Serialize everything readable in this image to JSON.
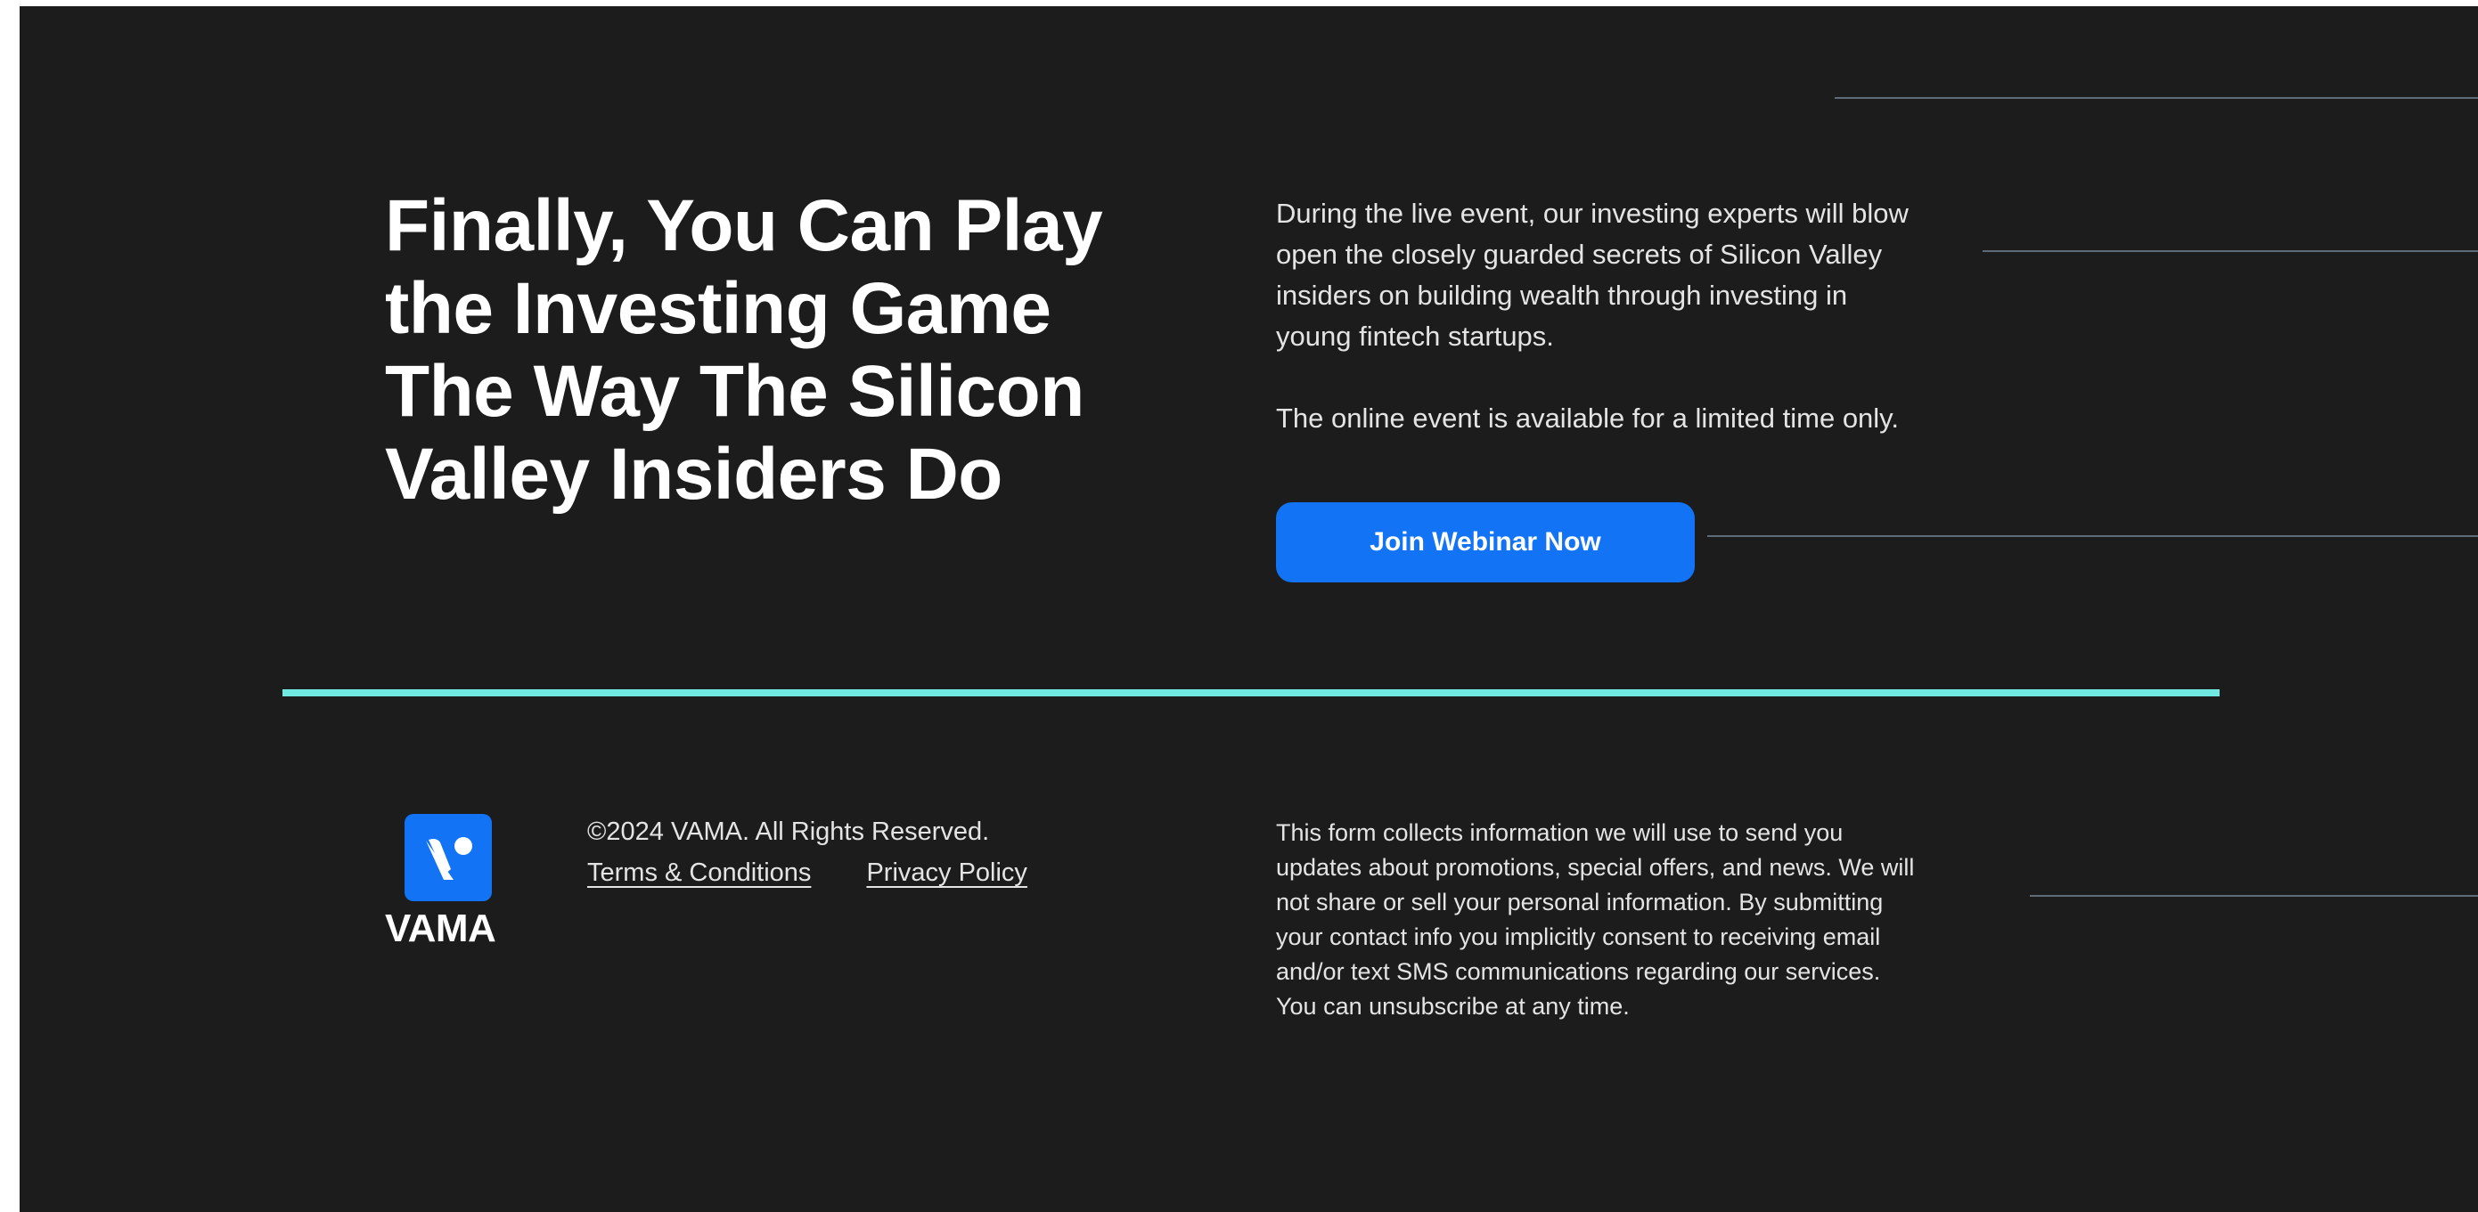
{
  "hero": {
    "headline_lines": [
      "Finally, You Can Play",
      "the Investing Game",
      "The Way The Silicon",
      "Valley Insiders Do"
    ],
    "intro_lines": [
      "During the live event, our investing experts will blow",
      "open the closely guarded secrets of Silicon Valley",
      "insiders on building wealth through investing in",
      "young fintech startups."
    ],
    "availability_text": "The online event is available for a limited time only.",
    "cta_label": "Join Webinar Now"
  },
  "footer": {
    "logo_text": "VAMA",
    "copyright": "©2024 VAMA. All Rights Reserved.",
    "links": {
      "terms": "Terms & Conditions",
      "privacy": "Privacy Policy"
    },
    "disclaimer_lines": [
      "This form collects information we will use to send you",
      "updates about promotions, special offers, and news. We will",
      "not share or sell your personal information. By submitting",
      "your contact info you implicitly consent to receiving email",
      "and/or text SMS communications regarding our services.",
      "You can unsubscribe at any time."
    ]
  },
  "colors": {
    "background": "#1c1c1c",
    "accent_blue": "#1274f5",
    "divider_teal": "#6ee8e1",
    "decorative_line": "#5e6a76"
  },
  "icons": {
    "logo_mark": "vama-logo-icon"
  }
}
